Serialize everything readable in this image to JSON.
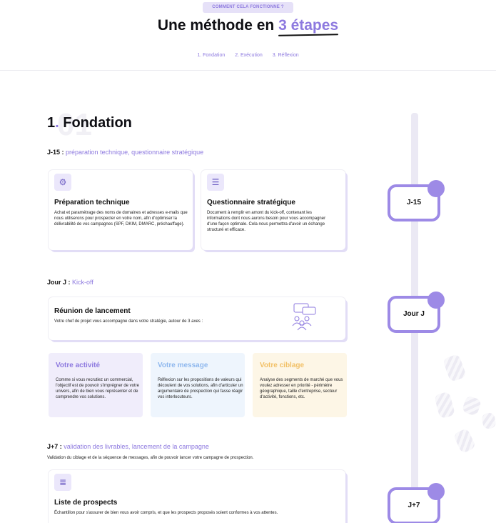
{
  "header": {
    "eyebrow": "COMMENT CELA FONCTIONNE ?",
    "title_start": "Une méthode en ",
    "title_accent": "3 étapes",
    "steps": [
      "1. Fondation",
      "2. Exécution",
      "3. Réflexion"
    ]
  },
  "section": {
    "bg_number": "01",
    "title": "Fondation",
    "title_num": "1",
    "title_dot": "."
  },
  "timeline": {
    "markers": [
      "J-15",
      "Jour J",
      "J+7"
    ]
  },
  "j15": {
    "prefix": "J-15 :",
    "highlight": "préparation technique, questionnaire stratégique",
    "cards": [
      {
        "icon": "gear-icon",
        "title": "Préparation technique",
        "text": "Achat et paramétrage des noms de domaines et adresses e-mails que nous utiliserons pour prospecter en votre nom, afin d'optimiser la délivrabilité de vos campagnes (SPF, DKIM, DMARC, préchauffage)."
      },
      {
        "icon": "document-icon",
        "title": "Questionnaire stratégique",
        "text": "Document à remplir en amont du kick-off, contenant les informations dont nous aurons besoin pour vous accompagner d'une façon optimale. Cela nous permettra d'avoir un échange structuré et efficace."
      }
    ]
  },
  "jourj": {
    "prefix": "Jour J :",
    "highlight": "Kick-off",
    "card": {
      "title": "Réunion de lancement",
      "text": "Votre chef de projet vous accompagne dans votre stratégie, autour de 3 axes :"
    },
    "axes": [
      {
        "title": "Votre activité",
        "color": "#8d79df",
        "bg": "#f0edfb",
        "text": "Comme si vous recrutiez un commercial, l'objectif est de pouvoir s'imprégner de votre univers, afin de bien vous représenter et de comprendre vos solutions."
      },
      {
        "title": "Votre message",
        "color": "#8fb8ee",
        "bg": "#eef5fd",
        "text": "Réflexion sur les propositions de valeurs qui découlent de vos solutions, afin d'articuler un argumentaire de prospection qui fasse réagir vos interlocuteurs."
      },
      {
        "title": "Votre ciblage",
        "color": "#f2c066",
        "bg": "#fdf6e6",
        "text": "Analyse des segments de marché que vous voulez adresser en priorité - périmètre géographique, taille d'entreprise, secteur d'activité, fonctions, etc."
      }
    ]
  },
  "j7": {
    "prefix": "J+7 :",
    "highlight": "validation des livrables, lancement de la campagne",
    "subtitle": "Validation du ciblage et de la séquence de messages, afin de pouvoir lancer votre campagne de prospection.",
    "card": {
      "icon": "list-icon",
      "title": "Liste de prospects",
      "text": "Échantillon pour s'assurer de bien vous avoir compris, et que les prospects proposés soient conformes à vos attentes."
    }
  }
}
